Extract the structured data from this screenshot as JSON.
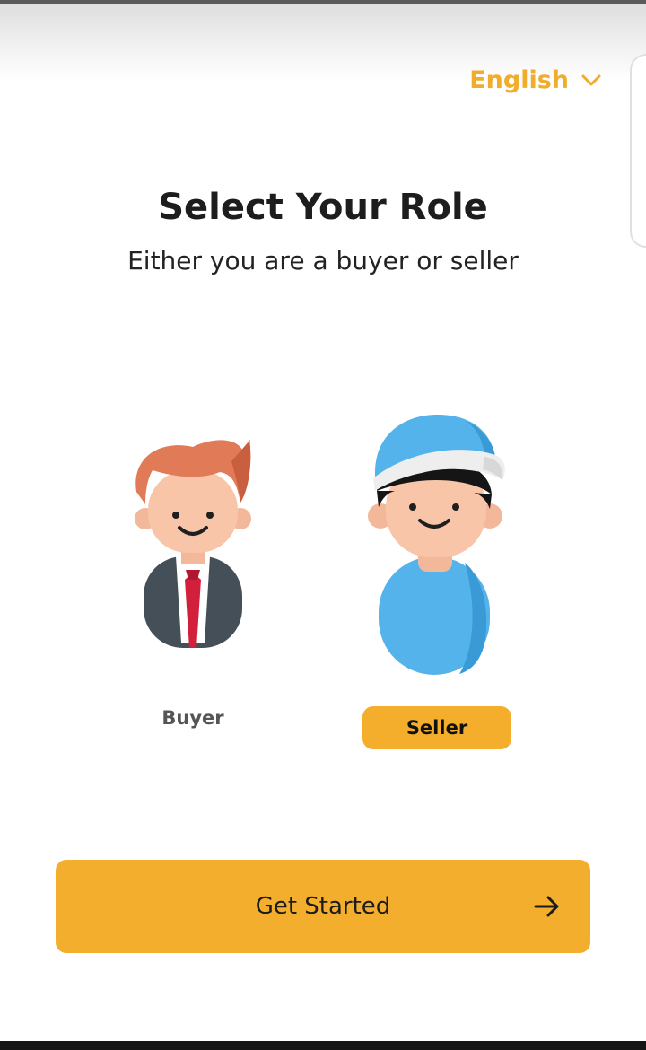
{
  "header": {
    "language": "English",
    "language_icon": "chevron-down-icon"
  },
  "main": {
    "title": "Select Your Role",
    "subtitle": "Either you are a buyer or seller"
  },
  "roles": [
    {
      "label": "Buyer",
      "icon": "buyer-avatar-icon",
      "selected": false
    },
    {
      "label": "Seller",
      "icon": "seller-avatar-icon",
      "selected": true
    }
  ],
  "cta": {
    "label": "Get Started",
    "icon": "arrow-right-icon"
  },
  "colors": {
    "accent": "#f4ae2c",
    "text_dark": "#1d1d1d",
    "text_muted": "#555555"
  }
}
